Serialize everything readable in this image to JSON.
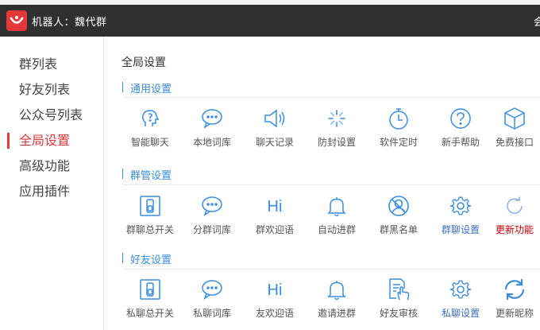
{
  "header": {
    "title": "机器人：魏代群",
    "edge_char": "会"
  },
  "sidebar": {
    "items": [
      {
        "label": "群列表"
      },
      {
        "label": "好友列表"
      },
      {
        "label": "公众号列表"
      },
      {
        "label": "全局设置",
        "active": true
      },
      {
        "label": "高级功能"
      },
      {
        "label": "应用插件"
      }
    ]
  },
  "main": {
    "page_title": "全局设置",
    "sections": [
      {
        "title": "通用设置",
        "items": [
          {
            "label": "智能聊天",
            "icon": "brain-head-icon"
          },
          {
            "label": "本地词库",
            "icon": "chat-bubble-icon"
          },
          {
            "label": "聊天记录",
            "icon": "speaker-icon"
          },
          {
            "label": "防封设置",
            "icon": "loading-spinner-icon"
          },
          {
            "label": "软件定时",
            "icon": "stopwatch-icon"
          },
          {
            "label": "新手帮助",
            "icon": "question-circle-icon"
          },
          {
            "label": "免费接口",
            "icon": "cube-icon"
          }
        ]
      },
      {
        "title": "群管设置",
        "items": [
          {
            "label": "群聊总开关",
            "icon": "toggle-switch-icon"
          },
          {
            "label": "分群词库",
            "icon": "chat-bubble-icon"
          },
          {
            "label": "群欢迎语",
            "icon": "hi-icon",
            "icon_text": "Hi"
          },
          {
            "label": "自动进群",
            "icon": "bell-icon"
          },
          {
            "label": "群黑名单",
            "icon": "user-block-icon"
          },
          {
            "label": "群聊设置",
            "icon": "gear-icon",
            "color": "blue"
          },
          {
            "label": "更新功能",
            "icon": "refresh-icon",
            "color": "red"
          }
        ]
      },
      {
        "title": "好友设置",
        "items": [
          {
            "label": "私聊总开关",
            "icon": "toggle-switch-icon"
          },
          {
            "label": "私聊词库",
            "icon": "chat-bubble-icon"
          },
          {
            "label": "友欢迎语",
            "icon": "hi-icon",
            "icon_text": "Hi"
          },
          {
            "label": "邀请进群",
            "icon": "bell-icon"
          },
          {
            "label": "好友审核",
            "icon": "document-hand-icon"
          },
          {
            "label": "私聊设置",
            "icon": "gear-icon",
            "color": "blue"
          },
          {
            "label": "更新昵称",
            "icon": "sync-arrows-icon"
          }
        ]
      }
    ]
  },
  "colors": {
    "accent": "#3c8dde",
    "active": "#e5383b",
    "header_bg": "#2f2f30",
    "red_label": "#d40000"
  }
}
